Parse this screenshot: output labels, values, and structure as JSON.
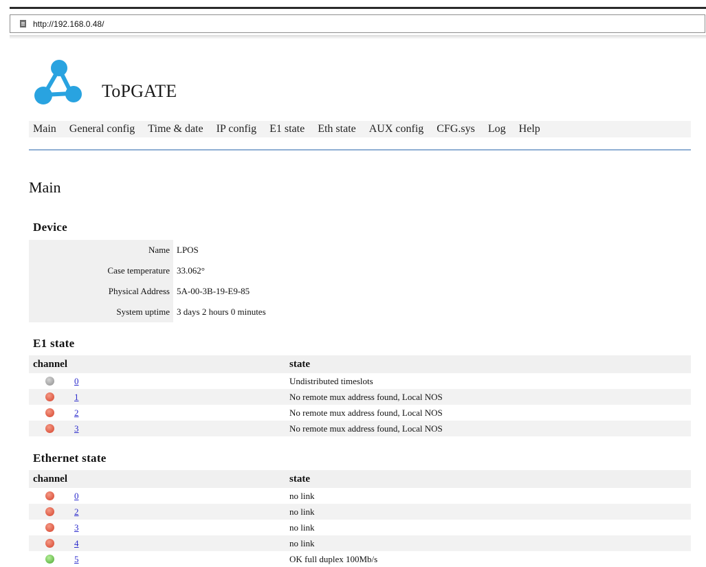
{
  "browser": {
    "url": "http://192.168.0.48/"
  },
  "header": {
    "brand": "ToPGATE"
  },
  "nav": [
    "Main",
    "General config",
    "Time & date",
    "IP config",
    "E1 state",
    "Eth state",
    "AUX config",
    "CFG.sys",
    "Log",
    "Help"
  ],
  "page_title": "Main",
  "device": {
    "title": "Device",
    "rows": [
      {
        "label": "Name",
        "value": "LPOS"
      },
      {
        "label": "Case temperature",
        "value": "33.062°"
      },
      {
        "label": "Physical Address",
        "value": "5A-00-3B-19-E9-85"
      },
      {
        "label": "System uptime",
        "value": "3 days 2 hours 0 minutes"
      }
    ]
  },
  "e1": {
    "title": "E1 state",
    "col_channel": "channel",
    "col_state": "state",
    "rows": [
      {
        "status": "gray",
        "channel": "0",
        "state": "Undistributed timeslots"
      },
      {
        "status": "red",
        "channel": "1",
        "state": "No remote mux address found, Local NOS"
      },
      {
        "status": "red",
        "channel": "2",
        "state": "No remote mux address found, Local NOS"
      },
      {
        "status": "red",
        "channel": "3",
        "state": "No remote mux address found, Local NOS"
      }
    ]
  },
  "eth": {
    "title": "Ethernet state",
    "col_channel": "channel",
    "col_state": "state",
    "rows": [
      {
        "status": "red",
        "channel": "0",
        "state": "no link"
      },
      {
        "status": "red",
        "channel": "2",
        "state": "no link"
      },
      {
        "status": "red",
        "channel": "3",
        "state": "no link"
      },
      {
        "status": "red",
        "channel": "4",
        "state": "no link"
      },
      {
        "status": "green",
        "channel": "5",
        "state": "OK full duplex 100Mb/s"
      }
    ]
  },
  "colors": {
    "red": "#d4412a",
    "gray": "#8d8d8d",
    "green": "#4aa530",
    "logo": "#29a3e0",
    "nav_rule": "#8eaed3"
  }
}
